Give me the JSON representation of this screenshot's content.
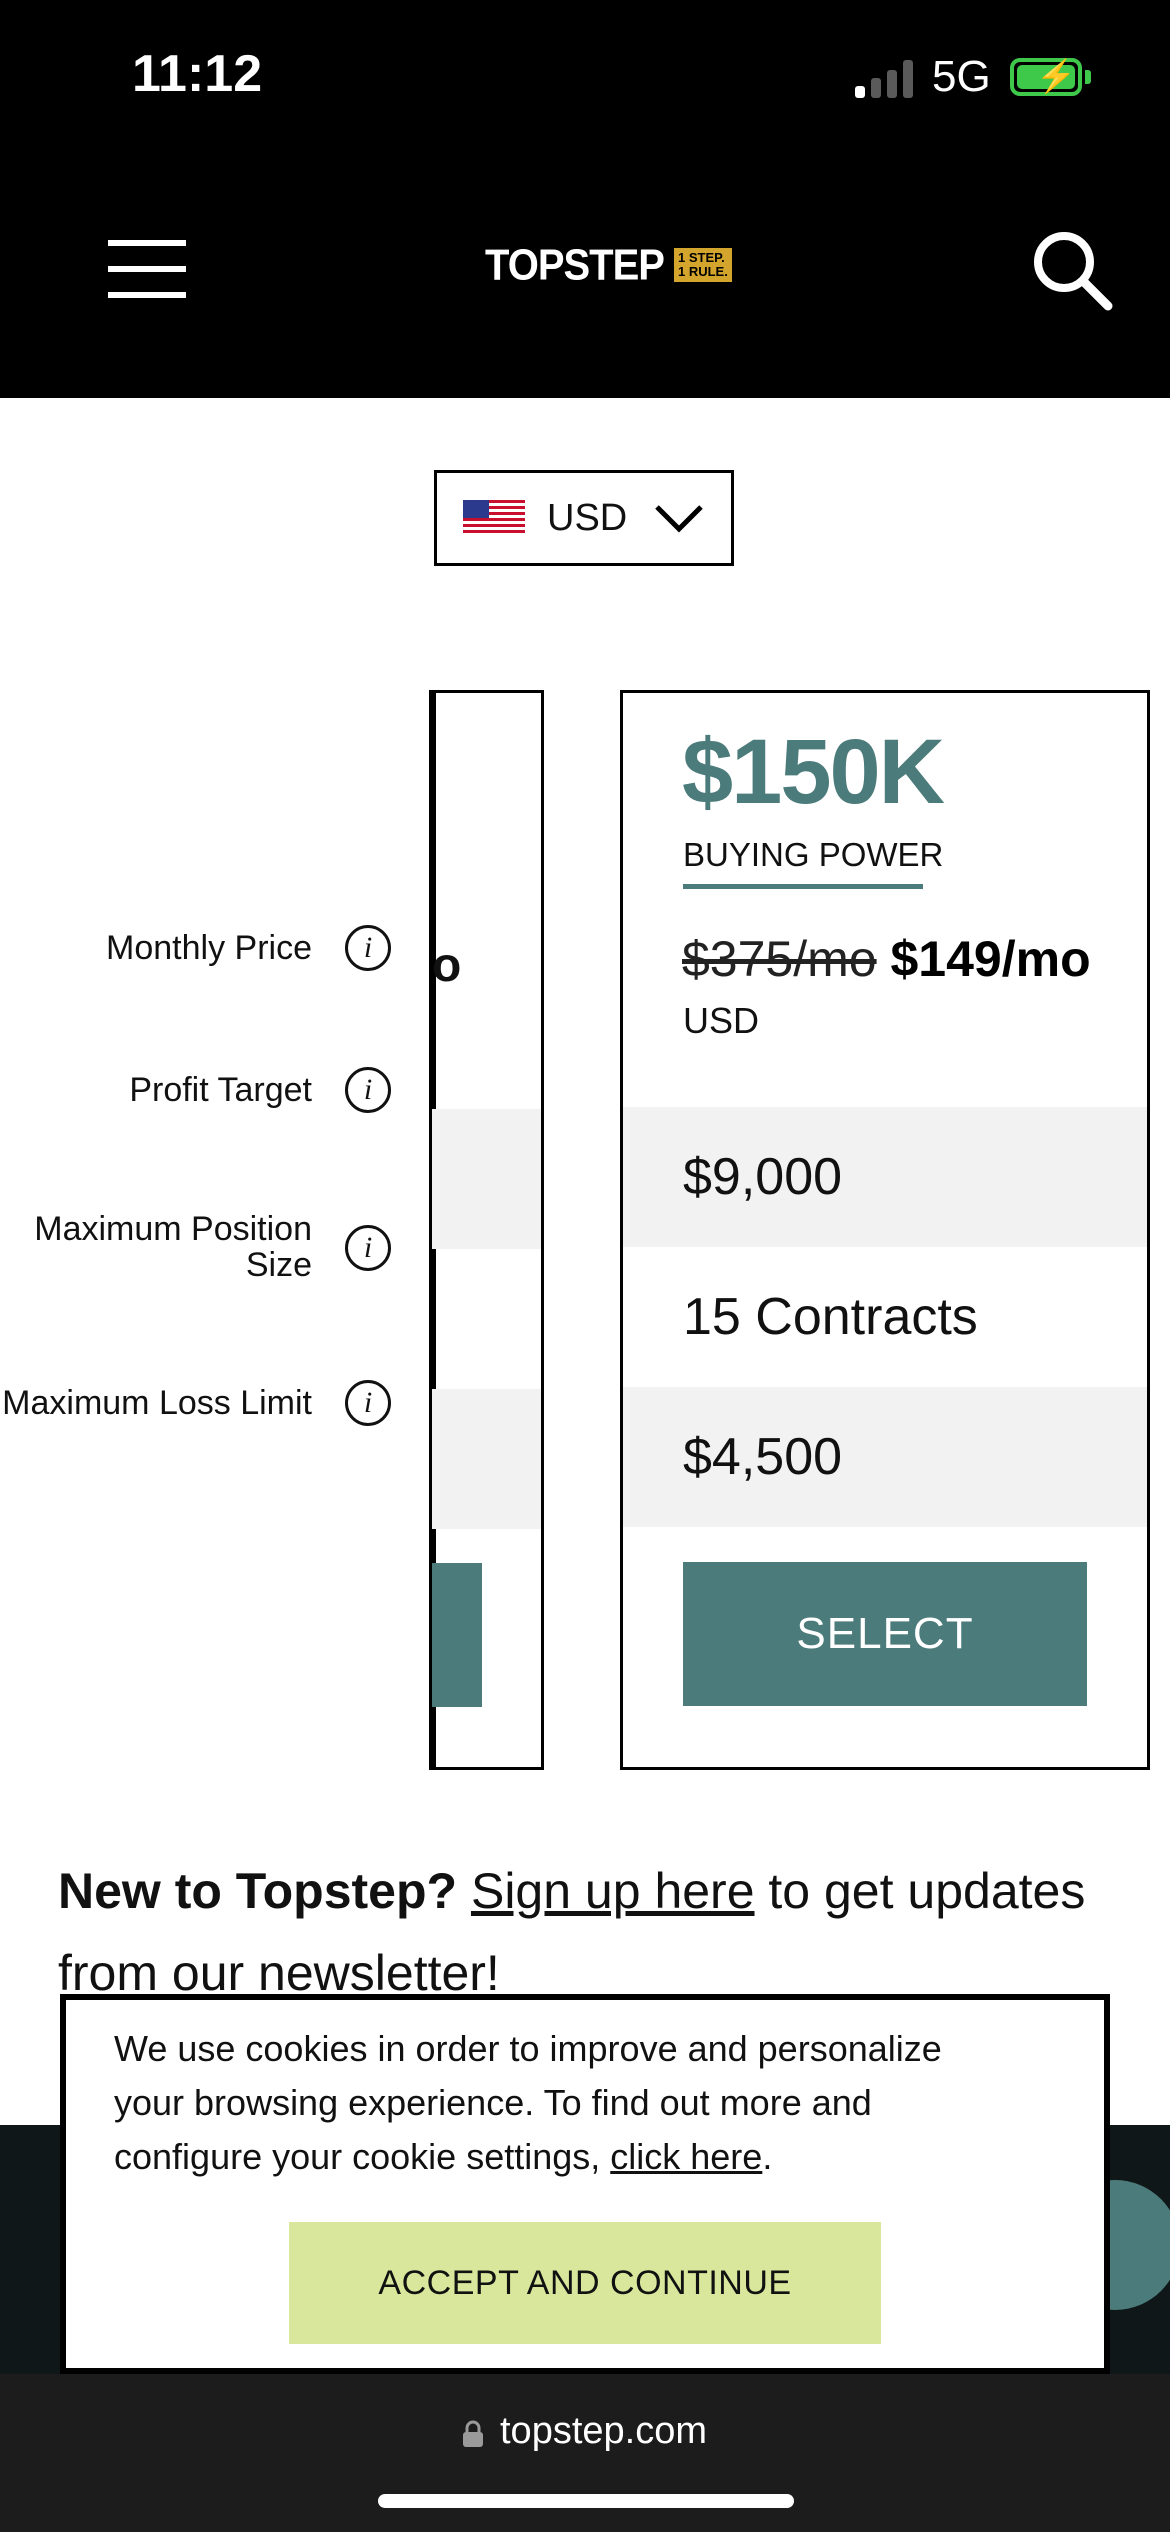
{
  "status_bar": {
    "time": "11:12",
    "network": "5G"
  },
  "header": {
    "logo_text": "TOPSTEP",
    "logo_tagline": "1 STEP. 1 RULE.",
    "menu_icon": "hamburger-icon",
    "search_icon": "search-icon"
  },
  "currency": {
    "selected": "USD",
    "flag_icon": "us-flag-icon",
    "chevron_icon": "chevron-down-icon"
  },
  "labels": {
    "monthly_price": "Monthly Price",
    "profit_target": "Profit Target",
    "max_position_line1": "Maximum Position",
    "max_position_line2": "Size",
    "max_loss": "Maximum Loss Limit"
  },
  "left_card": {
    "visible_fragment": "o"
  },
  "plan": {
    "amount": "$150K",
    "buying_power": "BUYING POWER",
    "old_price": "$375/mo",
    "new_price": "$149/mo",
    "currency": "USD",
    "profit_target": "$9,000",
    "max_position": "15 Contracts",
    "max_loss": "$4,500",
    "select_label": "SELECT"
  },
  "newsletter": {
    "lead": "New to Topstep?",
    "link": "Sign up here",
    "rest": " to get updates from our newsletter!"
  },
  "cookie": {
    "text_before": "We use cookies in order to improve and personalize your browsing experience. To find out more and configure your cookie settings, ",
    "link": "click here",
    "text_after": ".",
    "accept_label": "ACCEPT AND CONTINUE"
  },
  "browser": {
    "url": "topstep.com"
  },
  "colors": {
    "teal": "#4b7b7a",
    "accept": "#d8e79c",
    "gold": "#d4a52c",
    "battery": "#3fc94a"
  }
}
